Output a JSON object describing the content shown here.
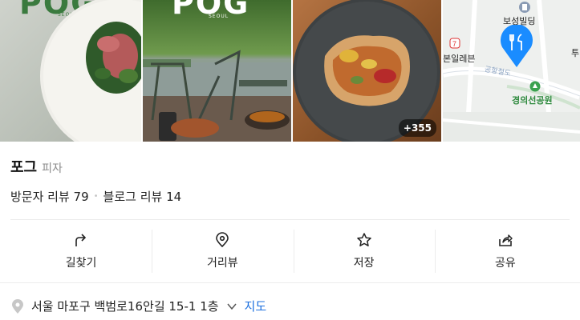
{
  "gallery": {
    "logo_text": "POG",
    "logo_sub": "SEOUL",
    "more_count": "+355"
  },
  "map": {
    "building_label": "보성빌딩",
    "cafe_label": "본일레븐",
    "street_label": "공항철도",
    "park_label": "경의선공원",
    "edge_label": "투"
  },
  "place": {
    "name": "포그",
    "category": "피자",
    "visitor_reviews": "방문자 리뷰 79",
    "blog_reviews": "블로그 리뷰 14"
  },
  "actions": {
    "directions": "길찾기",
    "street_view": "거리뷰",
    "save": "저장",
    "share": "공유"
  },
  "address": {
    "text": "서울 마포구 백범로16안길 15-1 1층",
    "map_link": "지도"
  },
  "colors": {
    "accent": "#1b6fde",
    "pin": "#1a8cff"
  }
}
